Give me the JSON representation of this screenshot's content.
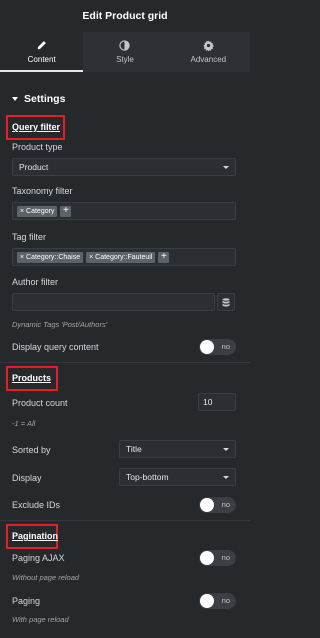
{
  "header": {
    "title": "Edit Product grid"
  },
  "tabs": [
    {
      "label": "Content",
      "icon": "pencil-icon",
      "active": true
    },
    {
      "label": "Style",
      "icon": "contrast-icon",
      "active": false
    },
    {
      "label": "Advanced",
      "icon": "gear-icon",
      "active": false
    }
  ],
  "settings": {
    "title": "Settings",
    "query_filter": {
      "heading": "Query filter",
      "product_type": {
        "label": "Product type",
        "value": "Product"
      },
      "taxonomy_filter": {
        "label": "Taxonomy filter",
        "tags": [
          "× Category"
        ]
      },
      "tag_filter": {
        "label": "Tag filter",
        "tags": [
          "× Category::Chaise",
          "× Category::Fauteuil"
        ]
      },
      "author_filter": {
        "label": "Author filter",
        "value": ""
      },
      "author_hint": "Dynamic Tags 'Post/Authors'",
      "display_query": {
        "label": "Display query content",
        "toggle": "no"
      }
    },
    "products": {
      "heading": "Products",
      "count": {
        "label": "Product count",
        "value": "10"
      },
      "count_hint": "-1 = All",
      "sorted_by": {
        "label": "Sorted by",
        "value": "Title"
      },
      "display": {
        "label": "Display",
        "value": "Top-bottom"
      },
      "exclude_ids": {
        "label": "Exclude IDs",
        "toggle": "no"
      }
    },
    "pagination": {
      "heading": "Pagination",
      "paging_ajax": {
        "label": "Paging AJAX",
        "toggle": "no",
        "hint": "Without page reload"
      },
      "paging": {
        "label": "Paging",
        "toggle": "no",
        "hint": "With page reload"
      }
    }
  },
  "colors": {
    "background": "#26292c",
    "highlight": "#e31e24",
    "chip": "#5c6268"
  }
}
